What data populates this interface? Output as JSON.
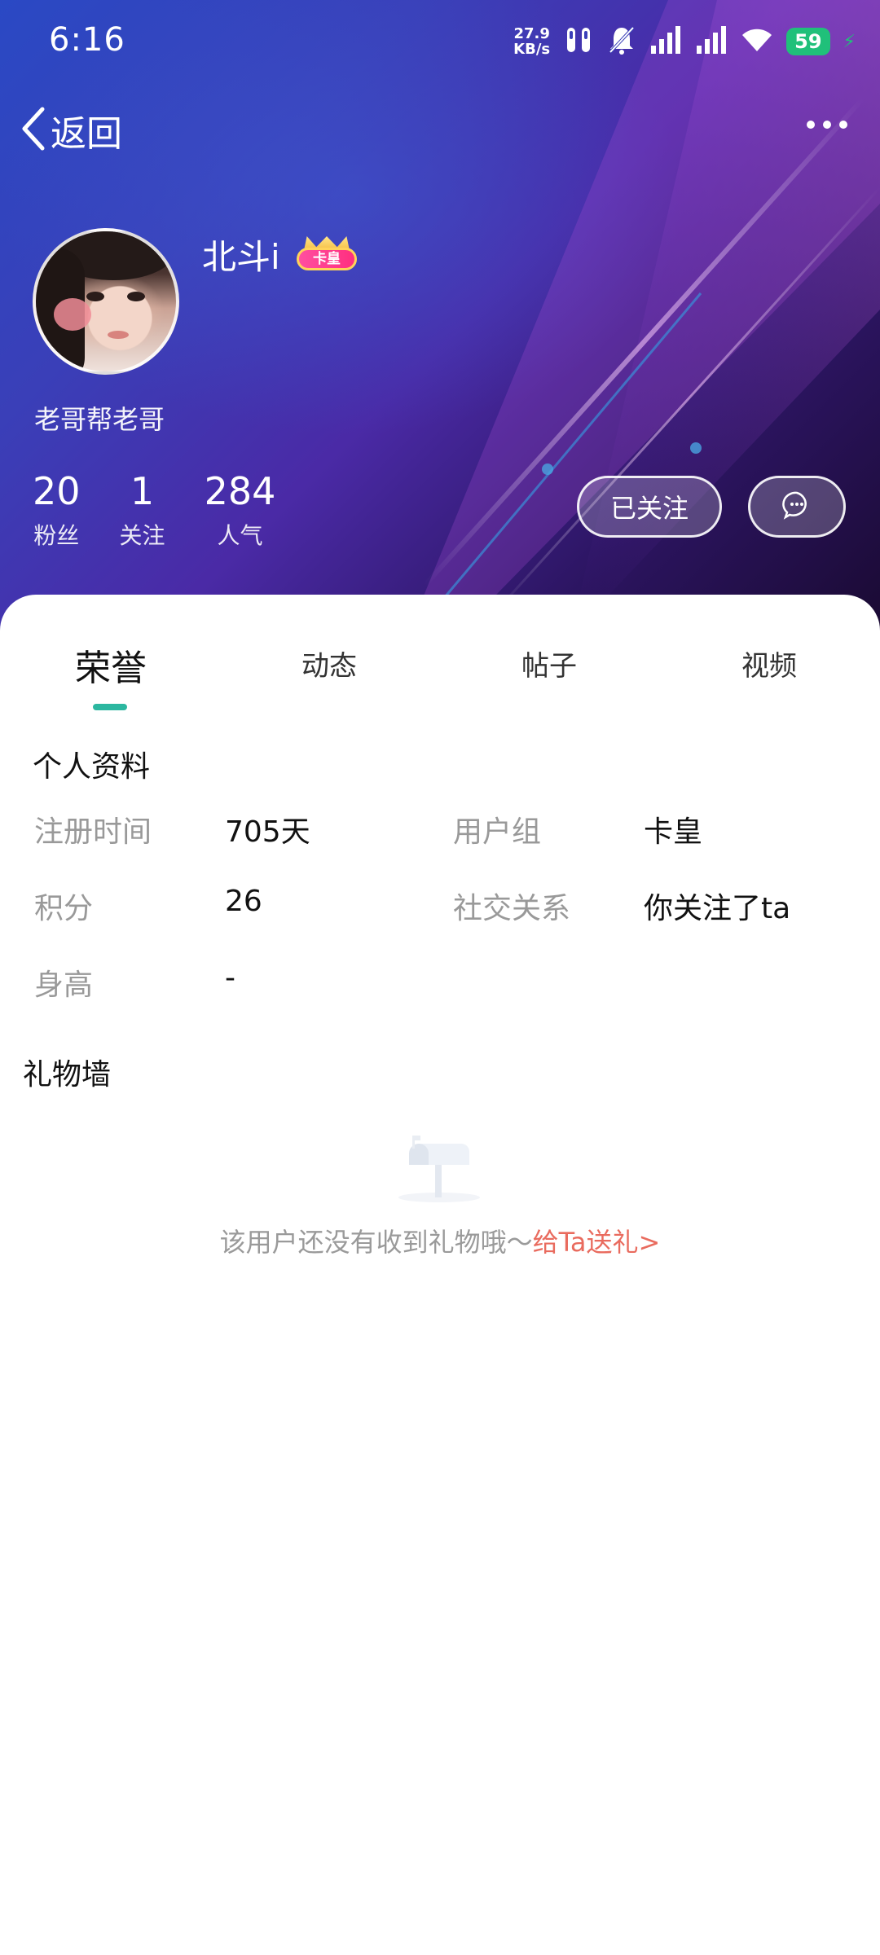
{
  "status_bar": {
    "time": "6:16",
    "net_speed_value": "27.9",
    "net_speed_unit": "KB/s",
    "battery": "59"
  },
  "nav": {
    "back_label": "返回"
  },
  "profile": {
    "username": "北斗i",
    "vip_badge": "卡皇",
    "signature": "老哥帮老哥",
    "stats": [
      {
        "value": "20",
        "label": "粉丝"
      },
      {
        "value": "1",
        "label": "关注"
      },
      {
        "value": "284",
        "label": "人气"
      }
    ],
    "follow_button": "已关注"
  },
  "tabs": [
    "荣誉",
    "动态",
    "帖子",
    "视频"
  ],
  "personal_info": {
    "title": "个人资料",
    "rows": [
      {
        "label": "注册时间",
        "value": "705天"
      },
      {
        "label": "用户组",
        "value": "卡皇"
      },
      {
        "label": "积分",
        "value": "26"
      },
      {
        "label": "社交关系",
        "value": "你关注了ta"
      },
      {
        "label": "身高",
        "value": "-"
      }
    ]
  },
  "gift_wall": {
    "title": "礼物墙",
    "empty_text": "该用户还没有收到礼物哦～",
    "gift_link": "给Ta送礼>"
  },
  "colors": {
    "accent_tab": "#2cb7a0",
    "gift_link": "#e96b5e",
    "battery": "#20c07a"
  }
}
